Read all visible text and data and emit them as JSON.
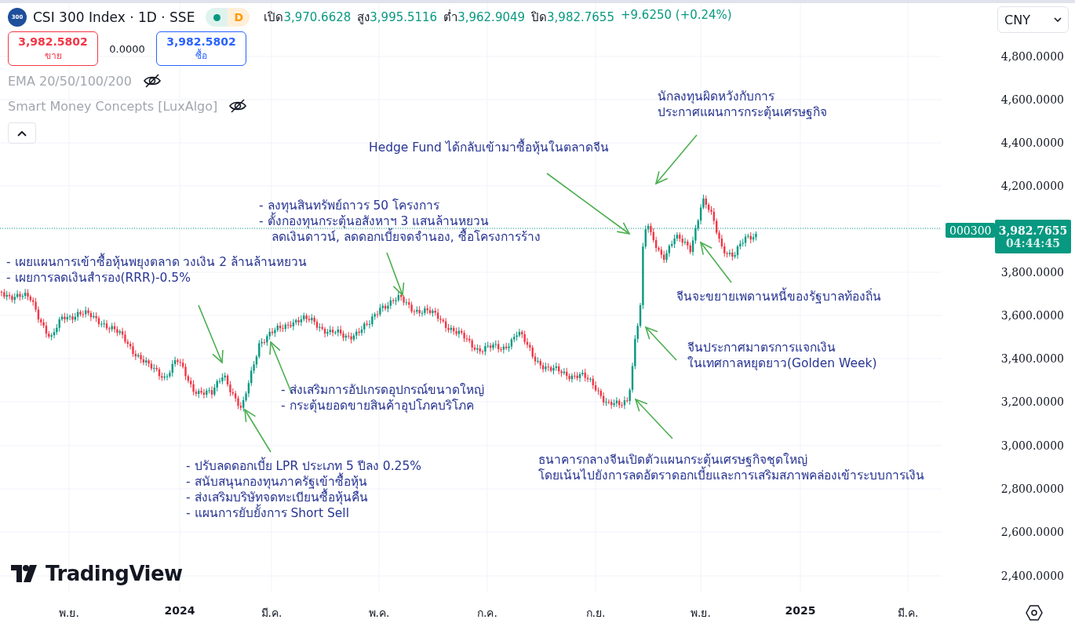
{
  "header": {
    "logo_text": "300",
    "title": "CSI 300 Index · 1D · SSE",
    "status_badge": "D",
    "ohlc": [
      {
        "label": "เปิด",
        "value": "3,970.6628"
      },
      {
        "label": "สูง",
        "value": "3,995.5116"
      },
      {
        "label": "ต่ำ",
        "value": "3,962.9049"
      },
      {
        "label": "ปิด",
        "value": "3,982.7655"
      }
    ],
    "change": "+9.6250 (+0.24%)"
  },
  "trade": {
    "sell": {
      "price": "3,982.5802",
      "label": "ขาย"
    },
    "spread": "0.0000",
    "buy": {
      "price": "3,982.5802",
      "label": "ซื้อ"
    }
  },
  "indicators": [
    {
      "name": "EMA 20/50/100/200",
      "hidden": true
    },
    {
      "name": "Smart Money Concepts [LuxAlgo]",
      "hidden": true
    }
  ],
  "currency": "CNY",
  "price_axis": [
    "4,800.0000",
    "4,600.0000",
    "4,400.0000",
    "4,200.0000",
    "3,800.0000",
    "3,600.0000",
    "3,400.0000",
    "3,200.0000",
    "3,000.0000",
    "2,800.0000",
    "2,600.0000",
    "2,400.0000"
  ],
  "last_price": {
    "symbol": "000300",
    "price": "3,982.7655",
    "countdown": "04:44:45"
  },
  "time_axis": [
    {
      "label": "พ.ย.",
      "bold": false
    },
    {
      "label": "2024",
      "bold": true
    },
    {
      "label": "มี.ค.",
      "bold": false
    },
    {
      "label": "พ.ค.",
      "bold": false
    },
    {
      "label": "ก.ค.",
      "bold": false
    },
    {
      "label": "ก.ย.",
      "bold": false
    },
    {
      "label": "พ.ย.",
      "bold": false
    },
    {
      "label": "2025",
      "bold": true
    },
    {
      "label": "มี.ค.",
      "bold": false
    }
  ],
  "annotations": [
    {
      "lines": [
        {
          "text": "- เผยแผนการเข้าซื้อหุ้นพยุงตลาด วงเงิน 2 ล้านล้านหยวน",
          "continuation": false
        },
        {
          "text": "- เผยการลดเงินสำรอง(RRR)-0.5%",
          "continuation": false
        }
      ]
    },
    {
      "lines": [
        {
          "text": "- ลงทุนสินทรัพย์ถาวร 50 โครงการ",
          "continuation": false
        },
        {
          "text": "- ตั้งกองทุนกระตุ้นอสังหาฯ 3 แสนล้านหยวน",
          "continuation": false
        },
        {
          "text": "ลดเงินดาวน์, ลดดอกเบี้ยจดจำนอง, ซื้อโครงการร้าง",
          "continuation": true
        }
      ]
    },
    {
      "lines": [
        {
          "text": "- ส่งเสริมการอัปเกรดอุปกรณ์ขนาดใหญ่",
          "continuation": false
        },
        {
          "text": "- กระตุ้นยอดขายสินค้าอุปโภคบริโภค",
          "continuation": false
        }
      ]
    },
    {
      "lines": [
        {
          "text": "- ปรับลดดอกเบี้ย LPR ประเภท 5 ปีลง 0.25%",
          "continuation": false
        },
        {
          "text": "- สนับสนุนกองทุนภาครัฐเข้าซื้อหุ้น",
          "continuation": false
        },
        {
          "text": "- ส่งเสริมบริษัทจดทะเบียนซื้อหุ้นคืน",
          "continuation": false
        },
        {
          "text": "- แผนการยับยั้งการ Short Sell",
          "continuation": false
        }
      ]
    },
    {
      "lines": [
        {
          "text": "Hedge Fund ได้กลับเข้ามาซื้อหุ้นในตลาดจีน",
          "continuation": false
        }
      ]
    },
    {
      "lines": [
        {
          "text": "นักลงทุนผิดหวังกับการ",
          "continuation": false
        },
        {
          "text": "ประกาศแผนการกระตุ้นเศรษฐกิจ",
          "continuation": false
        }
      ]
    },
    {
      "lines": [
        {
          "text": "จีนจะขยายเพดานหนี้ของรัฐบาลท้องถิ่น",
          "continuation": false
        }
      ]
    },
    {
      "lines": [
        {
          "text": "จีนประกาศมาตรการแจกเงิน",
          "continuation": false
        },
        {
          "text": "ในเทศกาลหยุดยาว(Golden Week)",
          "continuation": false
        }
      ]
    },
    {
      "lines": [
        {
          "text": "ธนาคารกลางจีนเปิดตัวแผนกระตุ้นเศรษฐกิจชุดใหญ่",
          "continuation": false
        },
        {
          "text": "โดยเน้นไปยังการลดอัตราดอกเบี้ยและการเสริมสภาพคล่องเข้าระบบการเงิน",
          "continuation": false
        }
      ]
    }
  ],
  "branding": "TradingView"
}
